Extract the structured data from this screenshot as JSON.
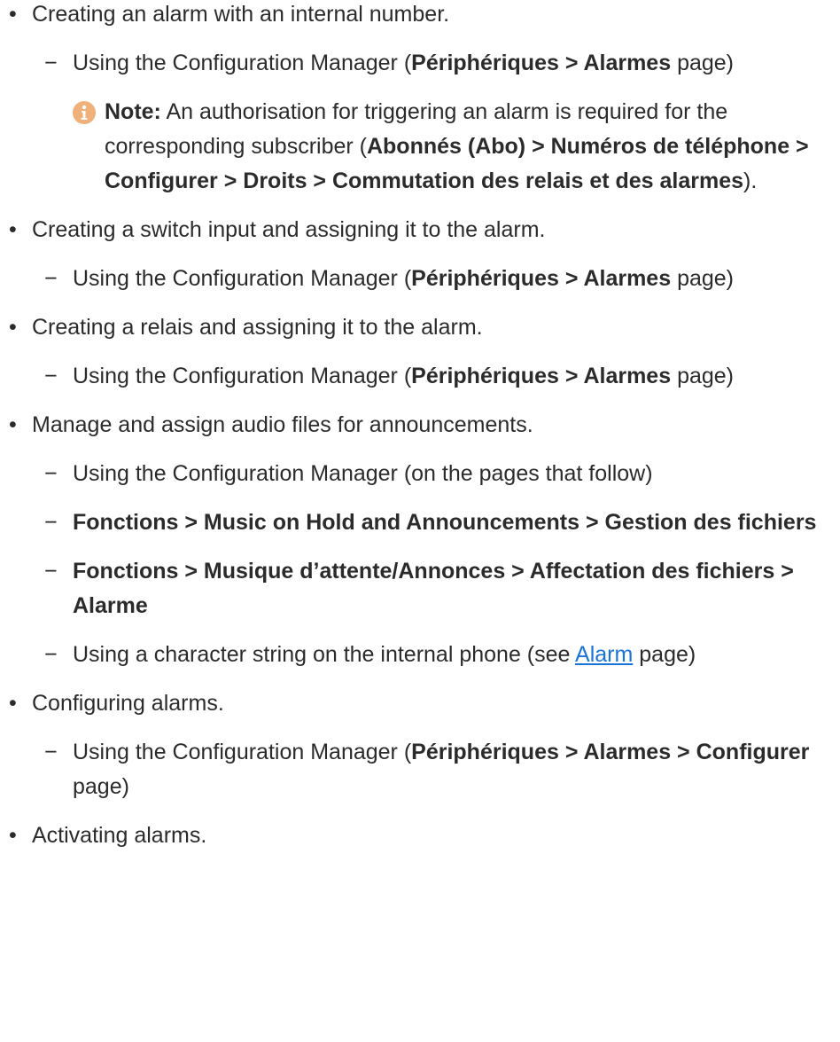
{
  "colors": {
    "text": "#2b2b2b",
    "link": "#1a73d9",
    "note_icon": "#f0b07a"
  },
  "icons": {
    "note": "info-icon"
  },
  "items": [
    {
      "text": "Creating an alarm with an internal number.",
      "sub": [
        {
          "prefix": "Using the Configuration Manager (",
          "bold": "Périphériques > Alarmes",
          "suffix": " page)"
        }
      ],
      "note": {
        "label": "Note:",
        "text_before": " An authorisation for triggering an alarm is required for the corresponding subscriber (",
        "bold": "Abonnés (Abo) > Numéros de téléphone > Configurer > Droits > Commutation des relais et des alarmes",
        "text_after": ")."
      }
    },
    {
      "text": "Creating a switch input and assigning it to the alarm.",
      "sub": [
        {
          "prefix": "Using the Configuration Manager (",
          "bold": "Périphériques > Alarmes",
          "suffix": " page)"
        }
      ]
    },
    {
      "text": "Creating a relais and assigning it to the alarm.",
      "sub": [
        {
          "prefix": "Using the Configuration Manager (",
          "bold": "Périphériques > Alarmes",
          "suffix": " page)"
        }
      ]
    },
    {
      "text": "Manage and assign audio files for announcements.",
      "sub": [
        {
          "text": "Using the Configuration Manager (on the pages that follow)"
        },
        {
          "bold": "Fonctions > Music on Hold and Announcements > Gestion des fichiers"
        },
        {
          "bold": "Fonctions > Musique d’attente/Annonces > Affectation des fichiers > Alarme"
        },
        {
          "prefix": "Using a character string on the internal phone (see ",
          "link": "Alarm",
          "suffix": " page)"
        }
      ]
    },
    {
      "text": "Configuring alarms.",
      "sub": [
        {
          "prefix": "Using the Configuration Manager (",
          "bold": "Périphériques > Alarmes > Configurer",
          "suffix": " page)"
        }
      ]
    },
    {
      "text": "Activating alarms."
    }
  ],
  "symbols": {
    "bullet": "•",
    "dash": "−"
  }
}
